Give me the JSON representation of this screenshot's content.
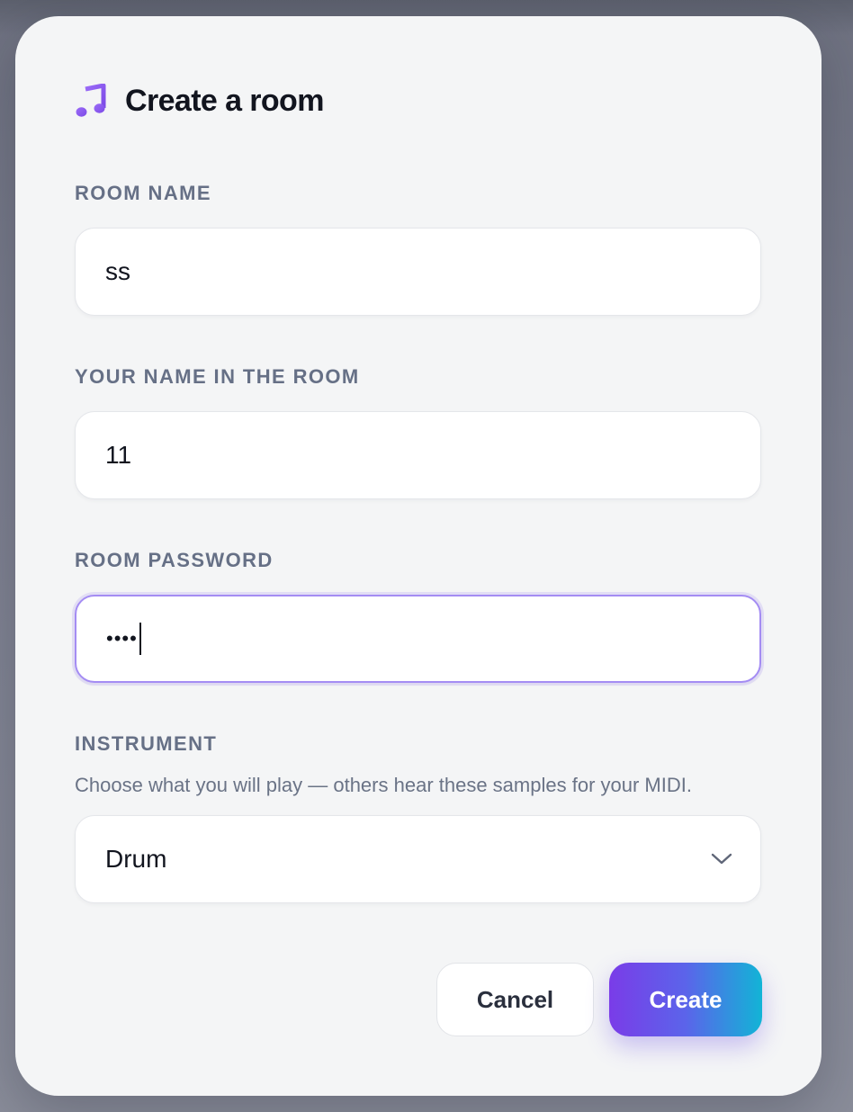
{
  "dialog": {
    "title": "Create a room",
    "title_icon": "music-note-icon"
  },
  "fields": {
    "room_name": {
      "label": "ROOM NAME",
      "value": "ss"
    },
    "your_name": {
      "label": "YOUR NAME IN THE ROOM",
      "value": "11"
    },
    "password": {
      "label": "ROOM PASSWORD",
      "masked_value": "••••",
      "focused": true
    },
    "instrument": {
      "label": "INSTRUMENT",
      "hint": "Choose what you will play — others hear these samples for your MIDI.",
      "selected": "Drum",
      "icon": "chevron-down-icon"
    }
  },
  "actions": {
    "cancel_label": "Cancel",
    "create_label": "Create"
  },
  "colors": {
    "accent_purple": "#8b5cf6",
    "gradient_start": "#7a3ce8",
    "gradient_end": "#12b4d6",
    "label_gray": "#667086",
    "title_dark": "#12151f"
  }
}
